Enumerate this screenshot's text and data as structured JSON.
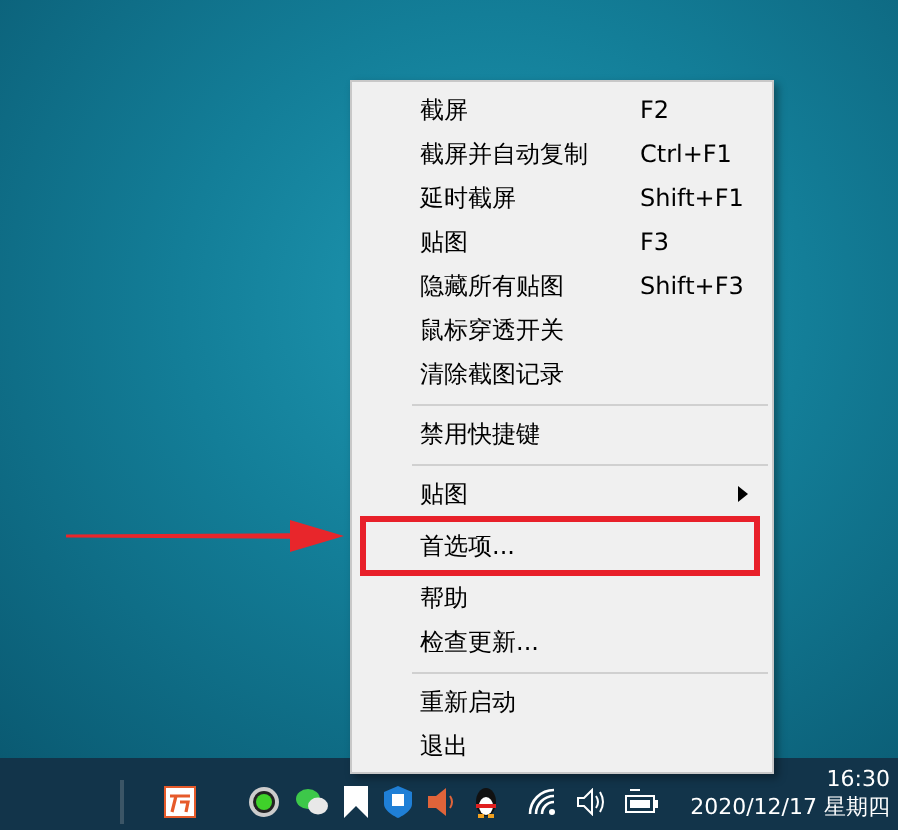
{
  "menu": {
    "items": [
      {
        "kind": "item",
        "label": "截屏",
        "shortcut": "F2",
        "highlighted": false
      },
      {
        "kind": "item",
        "label": "截屏并自动复制",
        "shortcut": "Ctrl+F1",
        "highlighted": false
      },
      {
        "kind": "item",
        "label": "延时截屏",
        "shortcut": "Shift+F1",
        "highlighted": false
      },
      {
        "kind": "item",
        "label": "贴图",
        "shortcut": "F3",
        "highlighted": false
      },
      {
        "kind": "item",
        "label": "隐藏所有贴图",
        "shortcut": "Shift+F3",
        "highlighted": false
      },
      {
        "kind": "item",
        "label": "鼠标穿透开关",
        "highlighted": false
      },
      {
        "kind": "item",
        "label": "清除截图记录",
        "highlighted": false
      },
      {
        "kind": "separator"
      },
      {
        "kind": "item",
        "label": "禁用快捷键",
        "highlighted": false
      },
      {
        "kind": "separator"
      },
      {
        "kind": "submenu",
        "label": "贴图",
        "highlighted": false
      },
      {
        "kind": "item",
        "label": "首选项...",
        "highlighted": true
      },
      {
        "kind": "item",
        "label": "帮助",
        "highlighted": false
      },
      {
        "kind": "item",
        "label": "检查更新...",
        "highlighted": false
      },
      {
        "kind": "separator"
      },
      {
        "kind": "item",
        "label": "重新启动",
        "highlighted": false
      },
      {
        "kind": "item",
        "label": "退出",
        "highlighted": false
      }
    ]
  },
  "taskbar": {
    "clock_time": "16:30",
    "clock_date": "2020/12/17 星期四"
  }
}
